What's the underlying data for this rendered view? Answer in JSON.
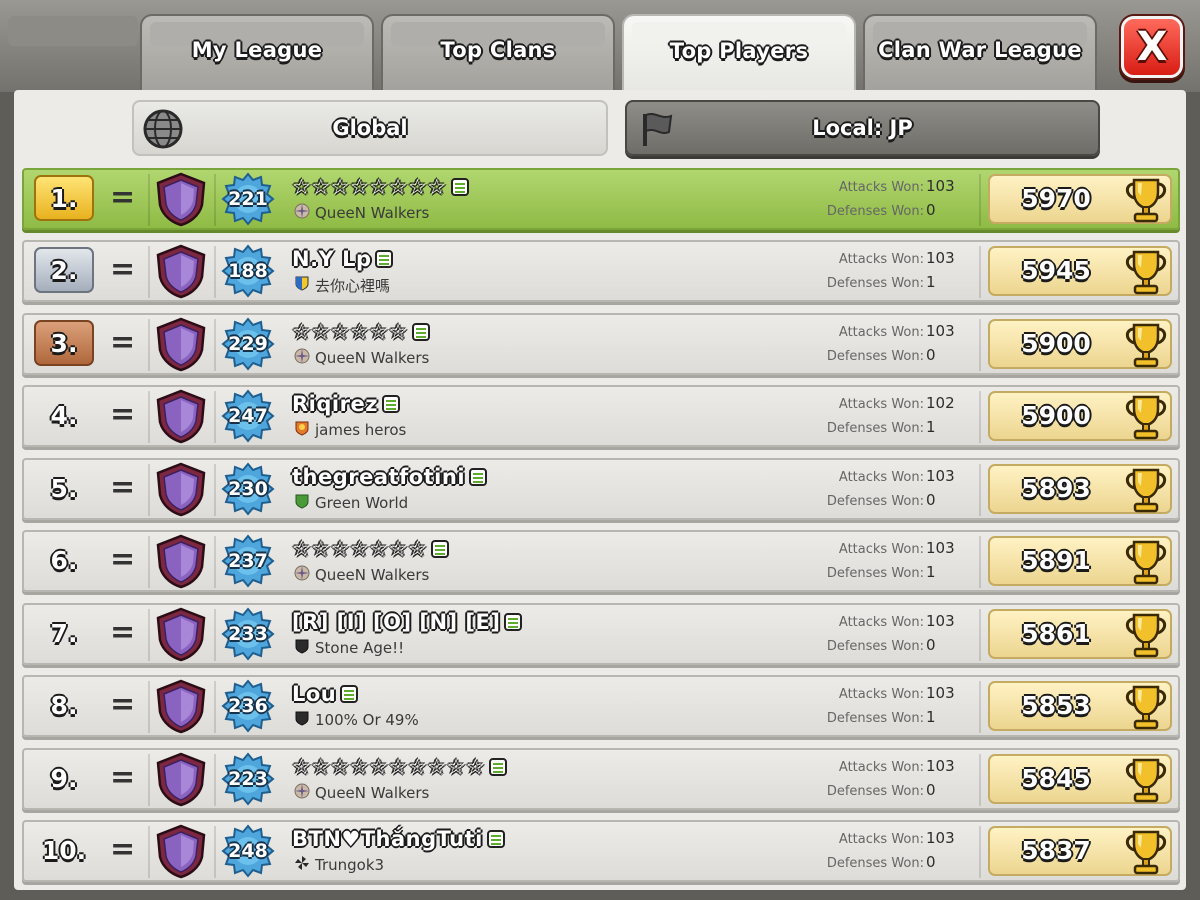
{
  "tabs": [
    {
      "label": "My League",
      "active": false
    },
    {
      "label": "Top Clans",
      "active": false
    },
    {
      "label": "Top Players",
      "active": true
    },
    {
      "label": "Clan War League",
      "active": false
    }
  ],
  "close_label": "X",
  "filters": {
    "global": "Global",
    "local": "Local: JP"
  },
  "stats_labels": {
    "attacks": "Attacks Won:",
    "defenses": "Defenses Won:"
  },
  "colors": {
    "first_row": "#9cc656",
    "trophy_box": "#f3dfa0",
    "close": "#e33226"
  },
  "players": [
    {
      "rank": "1.",
      "change": "=",
      "level": "221",
      "name": "☆☆☆☆☆☆☆☆",
      "clan": "QueeN Walkers",
      "clan_badge": "walkers",
      "attacks": "103",
      "defenses": "0",
      "trophies": "5970"
    },
    {
      "rank": "2.",
      "change": "=",
      "level": "188",
      "name": "N.Y Lp",
      "clan": "去你心裡嗎",
      "clan_badge": "blue-yellow",
      "attacks": "103",
      "defenses": "1",
      "trophies": "5945"
    },
    {
      "rank": "3.",
      "change": "=",
      "level": "229",
      "name": "☆☆☆☆☆☆",
      "clan": "QueeN Walkers",
      "clan_badge": "walkers",
      "attacks": "103",
      "defenses": "0",
      "trophies": "5900"
    },
    {
      "rank": "4.",
      "change": "=",
      "level": "247",
      "name": "Riqirez",
      "clan": "james heros",
      "clan_badge": "heros",
      "attacks": "102",
      "defenses": "1",
      "trophies": "5900"
    },
    {
      "rank": "5.",
      "change": "=",
      "level": "230",
      "name": "thegreatfotini",
      "clan": "Green World",
      "clan_badge": "green",
      "attacks": "103",
      "defenses": "0",
      "trophies": "5893"
    },
    {
      "rank": "6.",
      "change": "=",
      "level": "237",
      "name": "☆☆☆☆☆☆☆",
      "clan": "QueeN Walkers",
      "clan_badge": "walkers",
      "attacks": "103",
      "defenses": "1",
      "trophies": "5891"
    },
    {
      "rank": "7.",
      "change": "=",
      "level": "233",
      "name": "[R]  [I]  [O]  [N]  [E]",
      "clan": "Stone Age!!",
      "clan_badge": "black",
      "attacks": "103",
      "defenses": "0",
      "trophies": "5861"
    },
    {
      "rank": "8.",
      "change": "=",
      "level": "236",
      "name": "Lou",
      "clan": "100% Or 49%",
      "clan_badge": "black",
      "attacks": "103",
      "defenses": "1",
      "trophies": "5853"
    },
    {
      "rank": "9.",
      "change": "=",
      "level": "223",
      "name": "☆☆☆☆☆☆☆☆☆☆",
      "clan": "QueeN Walkers",
      "clan_badge": "walkers",
      "attacks": "103",
      "defenses": "0",
      "trophies": "5845"
    },
    {
      "rank": "10.",
      "change": "=",
      "level": "248",
      "name": "BTN♥ThắngTuti",
      "clan": "Trungok3",
      "clan_badge": "pinwheel",
      "attacks": "103",
      "defenses": "0",
      "trophies": "5837"
    }
  ]
}
